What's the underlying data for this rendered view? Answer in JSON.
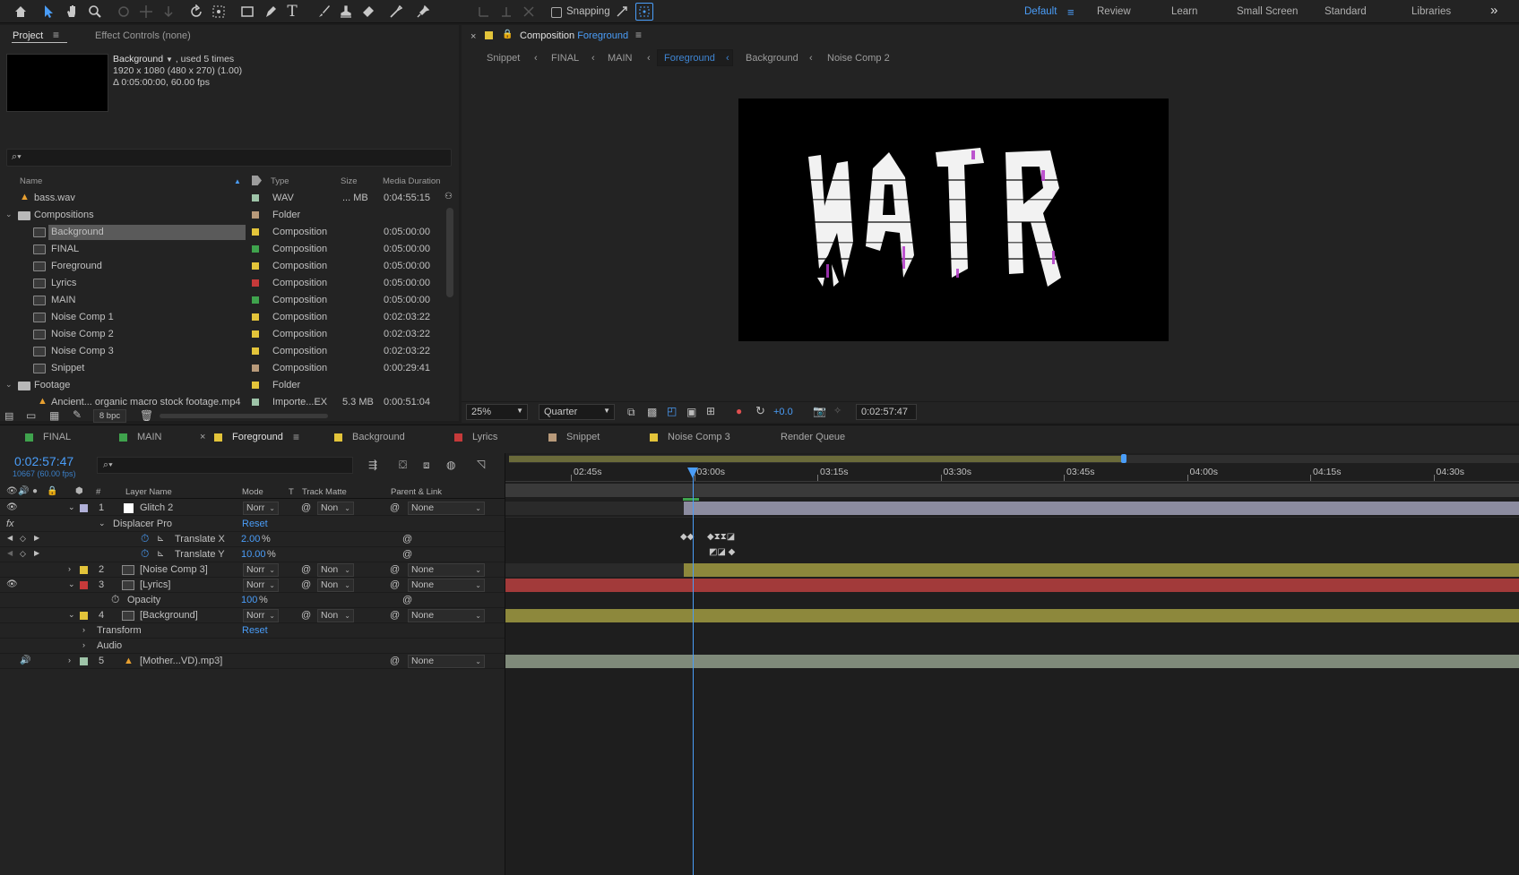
{
  "toolbar": {
    "snapping_label": "Snapping",
    "workspaces": [
      {
        "label": "Default",
        "active": true
      },
      {
        "label": "Review"
      },
      {
        "label": "Learn"
      },
      {
        "label": "Small Screen"
      },
      {
        "label": "Standard"
      },
      {
        "label": "Libraries"
      }
    ],
    "overflow": "»"
  },
  "project": {
    "tab_project": "Project",
    "tab_effects": "Effect Controls (none)",
    "selected_name": "Background",
    "selected_used": ", used 5 times",
    "selected_dims": "1920 x 1080  (480 x 270) (1.00)",
    "selected_dur": "Δ 0:05:00:00, 60.00 fps",
    "columns": {
      "name": "Name",
      "type": "Type",
      "size": "Size",
      "duration": "Media Duration"
    },
    "items": [
      {
        "name": "bass.wav",
        "kind": "audio",
        "color": "#9ec4a8",
        "type": "WAV",
        "size": "... MB",
        "duration": "0:04:55:15"
      },
      {
        "name": "Compositions",
        "kind": "folder",
        "color": "#b89a7a",
        "type": "Folder",
        "size": "",
        "duration": ""
      },
      {
        "name": "Background",
        "kind": "comp",
        "color": "#e3c43a",
        "type": "Composition",
        "size": "",
        "duration": "0:05:00:00",
        "selected": true
      },
      {
        "name": "FINAL",
        "kind": "comp",
        "color": "#3fa34d",
        "type": "Composition",
        "size": "",
        "duration": "0:05:00:00"
      },
      {
        "name": "Foreground",
        "kind": "comp",
        "color": "#e3c43a",
        "type": "Composition",
        "size": "",
        "duration": "0:05:00:00"
      },
      {
        "name": "Lyrics",
        "kind": "comp",
        "color": "#c63a3a",
        "type": "Composition",
        "size": "",
        "duration": "0:05:00:00"
      },
      {
        "name": "MAIN",
        "kind": "comp",
        "color": "#3fa34d",
        "type": "Composition",
        "size": "",
        "duration": "0:05:00:00"
      },
      {
        "name": "Noise Comp 1",
        "kind": "comp",
        "color": "#e3c43a",
        "type": "Composition",
        "size": "",
        "duration": "0:02:03:22"
      },
      {
        "name": "Noise Comp 2",
        "kind": "comp",
        "color": "#e3c43a",
        "type": "Composition",
        "size": "",
        "duration": "0:02:03:22"
      },
      {
        "name": "Noise Comp 3",
        "kind": "comp",
        "color": "#e3c43a",
        "type": "Composition",
        "size": "",
        "duration": "0:02:03:22"
      },
      {
        "name": "Snippet",
        "kind": "comp",
        "color": "#b89a7a",
        "type": "Composition",
        "size": "",
        "duration": "0:00:29:41"
      },
      {
        "name": "Footage",
        "kind": "folder",
        "color": "#e3c43a",
        "type": "Folder",
        "size": "",
        "duration": ""
      },
      {
        "name": "Ancient... organic macro stock footage.mp4",
        "kind": "video",
        "color": "#9ec4a8",
        "type": "Importe...EX",
        "size": "5.3 MB",
        "duration": "0:00:51:04"
      }
    ],
    "bpc": "8 bpc"
  },
  "viewer": {
    "tab_prefix": "Composition",
    "tab_name": "Foreground",
    "breadcrumbs": [
      {
        "label": "Snippet"
      },
      {
        "label": "FINAL"
      },
      {
        "label": "MAIN"
      },
      {
        "label": "Foreground",
        "active": true
      },
      {
        "label": "Background"
      },
      {
        "label": "Noise Comp 2"
      }
    ],
    "zoom": "25%",
    "resolution": "Quarter",
    "exposure": "+0.0",
    "timecode": "0:02:57:47"
  },
  "timeline_tabs": [
    {
      "label": "FINAL",
      "color": "#3fa34d"
    },
    {
      "label": "MAIN",
      "color": "#3fa34d"
    },
    {
      "label": "Foreground",
      "color": "#e3c43a",
      "active": true
    },
    {
      "label": "Background",
      "color": "#e3c43a"
    },
    {
      "label": "Lyrics",
      "color": "#c63a3a"
    },
    {
      "label": "Snippet",
      "color": "#b89a7a"
    },
    {
      "label": "Noise Comp 3",
      "color": "#e3c43a"
    },
    {
      "label": "Render Queue",
      "color": ""
    }
  ],
  "timeline": {
    "timecode": "0:02:57:47",
    "frame_info": "10667 (60.00 fps)",
    "headers": {
      "num": "#",
      "layer_name": "Layer Name",
      "mode": "Mode",
      "t": "T",
      "track_matte": "Track Matte",
      "parent": "Parent & Link"
    },
    "ruler": [
      "02:45s",
      "03:00s",
      "03:15s",
      "03:30s",
      "03:45s",
      "04:00s",
      "04:15s",
      "04:30s"
    ],
    "layers": {
      "l1": {
        "num": "1",
        "name": "Glitch 2",
        "mode": "Norr",
        "matte": "Non",
        "parent": "None",
        "color": "#d0d0d0"
      },
      "fx_name": "Displacer Pro",
      "reset": "Reset",
      "tx_label": "Translate X",
      "tx_value": "2.00",
      "ty_label": "Translate Y",
      "ty_value": "10.00",
      "pct": "%",
      "l2": {
        "num": "2",
        "name": "[Noise Comp 3]",
        "mode": "Norr",
        "matte": "Non",
        "parent": "None"
      },
      "l3": {
        "num": "3",
        "name": "[Lyrics]",
        "mode": "Norr",
        "matte": "Non",
        "parent": "None"
      },
      "opacity_label": "Opacity",
      "opacity_value": "100",
      "l4": {
        "num": "4",
        "name": "[Background]",
        "mode": "Norr",
        "matte": "Non",
        "parent": "None"
      },
      "transform_label": "Transform",
      "audio_label": "Audio",
      "l5": {
        "num": "5",
        "name": "[Mother...VD).mp3]",
        "parent": "None"
      }
    }
  }
}
